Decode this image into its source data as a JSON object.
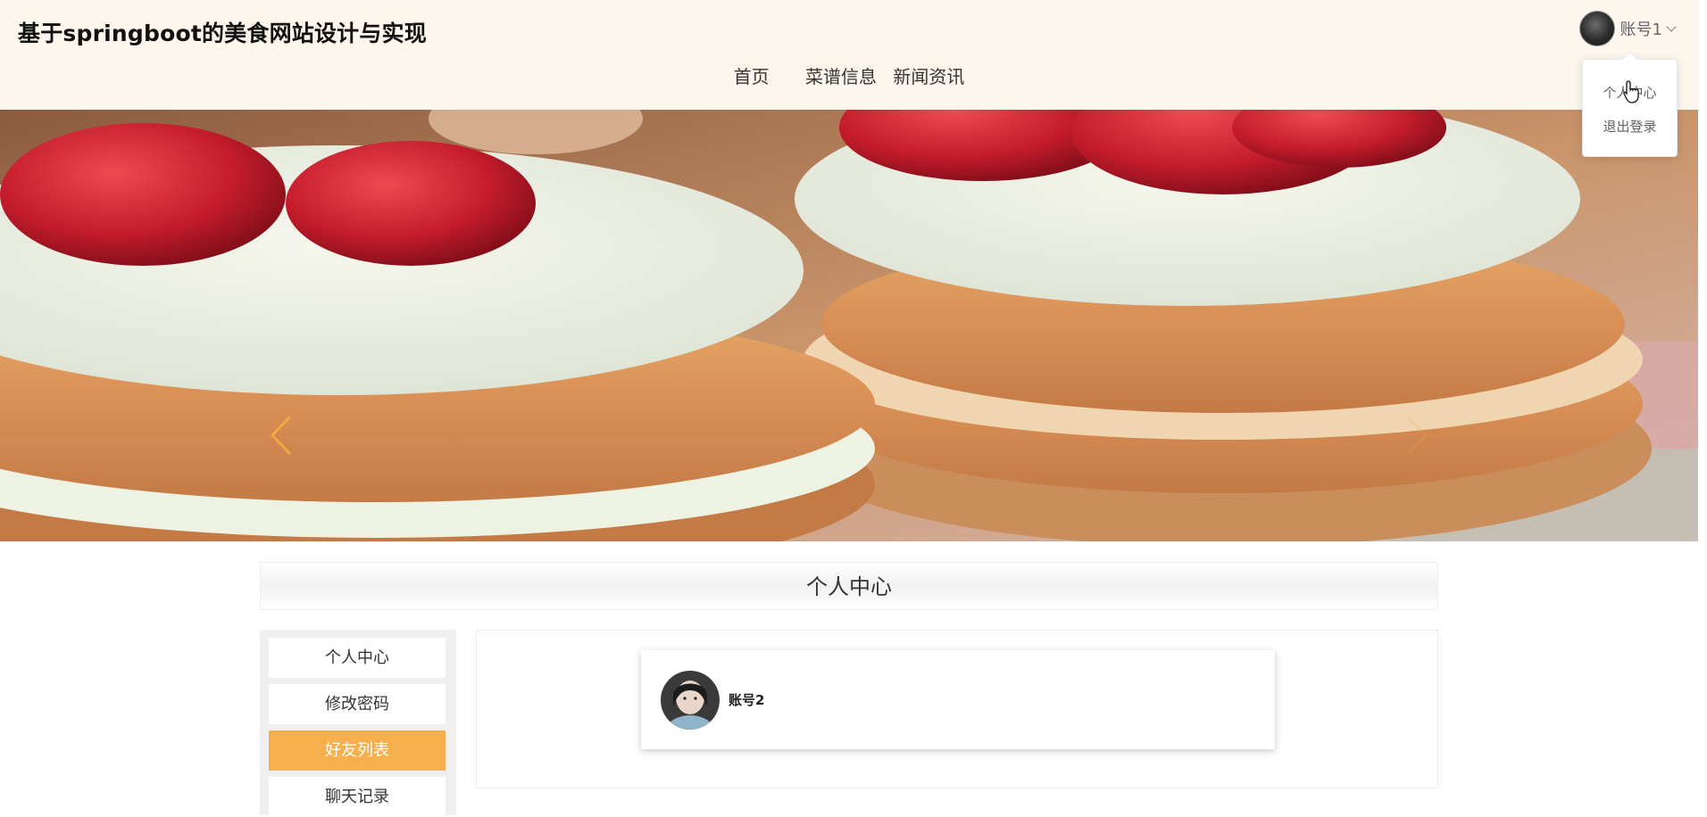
{
  "header": {
    "site_title": "基于springboot的美食网站设计与实现",
    "background_color": "#fdf6ec"
  },
  "nav": {
    "items": [
      {
        "label": "首页"
      },
      {
        "label": "菜谱信息"
      },
      {
        "label": "新闻资讯"
      }
    ]
  },
  "user_menu": {
    "username": "账号1",
    "dropdown": [
      {
        "label": "个人中心"
      },
      {
        "label": "退出登录"
      }
    ]
  },
  "banner": {
    "arrow_color": "#f0a940"
  },
  "section": {
    "title": "个人中心"
  },
  "sidebar": {
    "items": [
      {
        "label": "个人中心",
        "active": false
      },
      {
        "label": "修改密码",
        "active": false
      },
      {
        "label": "好友列表",
        "active": true
      },
      {
        "label": "聊天记录",
        "active": false
      }
    ],
    "accent_color": "#f5b04d"
  },
  "friends": [
    {
      "name": "账号2"
    }
  ]
}
